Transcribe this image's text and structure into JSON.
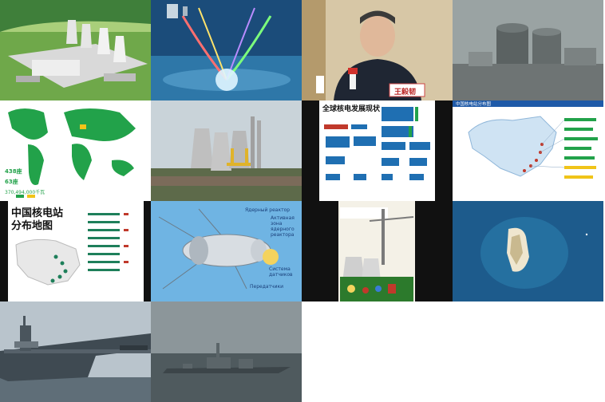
{
  "gallery": {
    "tiles": [
      {
        "id": "plant-rendering"
      },
      {
        "id": "offshore-reactor-beams"
      },
      {
        "id": "speaker-portrait",
        "nameplate": "王毅韧"
      },
      {
        "id": "foggy-plant"
      },
      {
        "id": "world-map",
        "stat_a": "438座",
        "stat_b": "63座",
        "stat_c": "370,494,000千瓦"
      },
      {
        "id": "cooling-towers"
      },
      {
        "id": "infographic-status",
        "title": "全球核电发展现状"
      },
      {
        "id": "china-plant-map",
        "title": "中国核电站分布图"
      },
      {
        "id": "china-map-poster",
        "title_line1": "中国核电站",
        "title_line2": "分布地图"
      },
      {
        "id": "satellite-reactor",
        "labels": [
          "Ядерный реактор",
          "Активная зона ядерного реактора",
          "Система датчиков",
          "Передатчики"
        ]
      },
      {
        "id": "reactor-diagram"
      },
      {
        "id": "island-satellite"
      },
      {
        "id": "aircraft-carrier"
      },
      {
        "id": "destroyer"
      },
      {
        "id": "empty-1"
      },
      {
        "id": "empty-2"
      }
    ]
  },
  "colors": {
    "sky": "#9dc3e6",
    "sea": "#1e5f8a",
    "green_map": "#22a24a",
    "poster_bg": "#ffffff",
    "accent_red": "#c0392b"
  }
}
